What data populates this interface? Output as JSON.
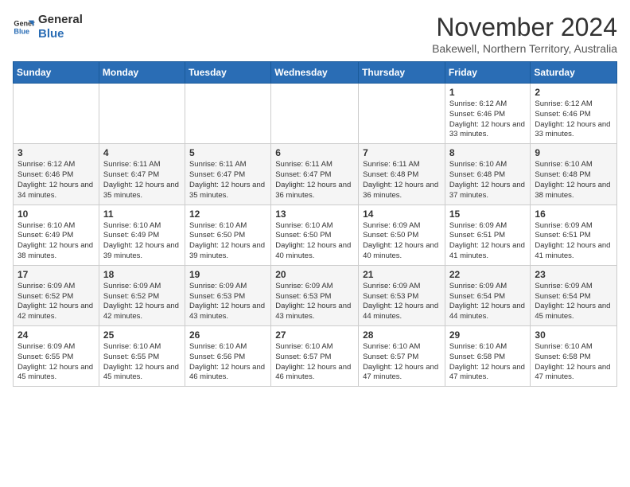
{
  "logo": {
    "line1": "General",
    "line2": "Blue"
  },
  "title": "November 2024",
  "location": "Bakewell, Northern Territory, Australia",
  "days_of_week": [
    "Sunday",
    "Monday",
    "Tuesday",
    "Wednesday",
    "Thursday",
    "Friday",
    "Saturday"
  ],
  "weeks": [
    [
      {
        "day": "",
        "text": ""
      },
      {
        "day": "",
        "text": ""
      },
      {
        "day": "",
        "text": ""
      },
      {
        "day": "",
        "text": ""
      },
      {
        "day": "",
        "text": ""
      },
      {
        "day": "1",
        "text": "Sunrise: 6:12 AM\nSunset: 6:46 PM\nDaylight: 12 hours and 33 minutes."
      },
      {
        "day": "2",
        "text": "Sunrise: 6:12 AM\nSunset: 6:46 PM\nDaylight: 12 hours and 33 minutes."
      }
    ],
    [
      {
        "day": "3",
        "text": "Sunrise: 6:12 AM\nSunset: 6:46 PM\nDaylight: 12 hours and 34 minutes."
      },
      {
        "day": "4",
        "text": "Sunrise: 6:11 AM\nSunset: 6:47 PM\nDaylight: 12 hours and 35 minutes."
      },
      {
        "day": "5",
        "text": "Sunrise: 6:11 AM\nSunset: 6:47 PM\nDaylight: 12 hours and 35 minutes."
      },
      {
        "day": "6",
        "text": "Sunrise: 6:11 AM\nSunset: 6:47 PM\nDaylight: 12 hours and 36 minutes."
      },
      {
        "day": "7",
        "text": "Sunrise: 6:11 AM\nSunset: 6:48 PM\nDaylight: 12 hours and 36 minutes."
      },
      {
        "day": "8",
        "text": "Sunrise: 6:10 AM\nSunset: 6:48 PM\nDaylight: 12 hours and 37 minutes."
      },
      {
        "day": "9",
        "text": "Sunrise: 6:10 AM\nSunset: 6:48 PM\nDaylight: 12 hours and 38 minutes."
      }
    ],
    [
      {
        "day": "10",
        "text": "Sunrise: 6:10 AM\nSunset: 6:49 PM\nDaylight: 12 hours and 38 minutes."
      },
      {
        "day": "11",
        "text": "Sunrise: 6:10 AM\nSunset: 6:49 PM\nDaylight: 12 hours and 39 minutes."
      },
      {
        "day": "12",
        "text": "Sunrise: 6:10 AM\nSunset: 6:50 PM\nDaylight: 12 hours and 39 minutes."
      },
      {
        "day": "13",
        "text": "Sunrise: 6:10 AM\nSunset: 6:50 PM\nDaylight: 12 hours and 40 minutes."
      },
      {
        "day": "14",
        "text": "Sunrise: 6:09 AM\nSunset: 6:50 PM\nDaylight: 12 hours and 40 minutes."
      },
      {
        "day": "15",
        "text": "Sunrise: 6:09 AM\nSunset: 6:51 PM\nDaylight: 12 hours and 41 minutes."
      },
      {
        "day": "16",
        "text": "Sunrise: 6:09 AM\nSunset: 6:51 PM\nDaylight: 12 hours and 41 minutes."
      }
    ],
    [
      {
        "day": "17",
        "text": "Sunrise: 6:09 AM\nSunset: 6:52 PM\nDaylight: 12 hours and 42 minutes."
      },
      {
        "day": "18",
        "text": "Sunrise: 6:09 AM\nSunset: 6:52 PM\nDaylight: 12 hours and 42 minutes."
      },
      {
        "day": "19",
        "text": "Sunrise: 6:09 AM\nSunset: 6:53 PM\nDaylight: 12 hours and 43 minutes."
      },
      {
        "day": "20",
        "text": "Sunrise: 6:09 AM\nSunset: 6:53 PM\nDaylight: 12 hours and 43 minutes."
      },
      {
        "day": "21",
        "text": "Sunrise: 6:09 AM\nSunset: 6:53 PM\nDaylight: 12 hours and 44 minutes."
      },
      {
        "day": "22",
        "text": "Sunrise: 6:09 AM\nSunset: 6:54 PM\nDaylight: 12 hours and 44 minutes."
      },
      {
        "day": "23",
        "text": "Sunrise: 6:09 AM\nSunset: 6:54 PM\nDaylight: 12 hours and 45 minutes."
      }
    ],
    [
      {
        "day": "24",
        "text": "Sunrise: 6:09 AM\nSunset: 6:55 PM\nDaylight: 12 hours and 45 minutes."
      },
      {
        "day": "25",
        "text": "Sunrise: 6:10 AM\nSunset: 6:55 PM\nDaylight: 12 hours and 45 minutes."
      },
      {
        "day": "26",
        "text": "Sunrise: 6:10 AM\nSunset: 6:56 PM\nDaylight: 12 hours and 46 minutes."
      },
      {
        "day": "27",
        "text": "Sunrise: 6:10 AM\nSunset: 6:57 PM\nDaylight: 12 hours and 46 minutes."
      },
      {
        "day": "28",
        "text": "Sunrise: 6:10 AM\nSunset: 6:57 PM\nDaylight: 12 hours and 47 minutes."
      },
      {
        "day": "29",
        "text": "Sunrise: 6:10 AM\nSunset: 6:58 PM\nDaylight: 12 hours and 47 minutes."
      },
      {
        "day": "30",
        "text": "Sunrise: 6:10 AM\nSunset: 6:58 PM\nDaylight: 12 hours and 47 minutes."
      }
    ]
  ]
}
